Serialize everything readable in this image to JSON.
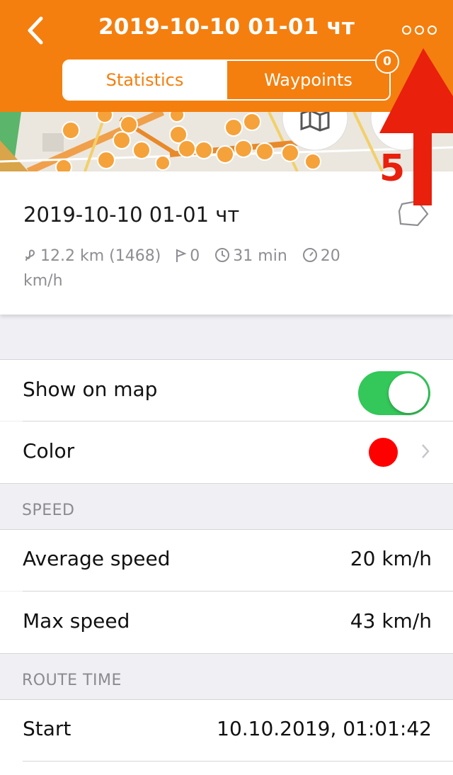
{
  "header": {
    "title": "2019-10-10 01-01 чт",
    "tabs": [
      {
        "label": "Statistics",
        "active": true
      },
      {
        "label": "Waypoints",
        "active": false
      }
    ],
    "waypoints_badge": "0",
    "accent_color": "#f47f0e"
  },
  "track": {
    "name": "2019-10-10 01-01 чт",
    "distance": "12.2 km (1468)",
    "waypoints": "0",
    "duration": "31 min",
    "speed": "20",
    "speed_unit": "km/h"
  },
  "settings": {
    "show_on_map_label": "Show on map",
    "show_on_map": true,
    "color_label": "Color",
    "color_value": "#ff0000"
  },
  "speed_section": {
    "header": "SPEED",
    "rows": [
      {
        "label": "Average speed",
        "value": "20 km/h"
      },
      {
        "label": "Max speed",
        "value": "43 km/h"
      }
    ]
  },
  "route_time_section": {
    "header": "ROUTE TIME",
    "rows": [
      {
        "label": "Start",
        "value": "10.10.2019, 01:01:42"
      }
    ]
  },
  "annotation": {
    "step_number": "5",
    "color": "#e8200c"
  },
  "icons": [
    "back-chevron-icon",
    "more-icon",
    "map-icon",
    "polygon-icon",
    "route-icon",
    "flag-icon",
    "clock-icon",
    "speedometer-icon",
    "chevron-right-icon"
  ]
}
